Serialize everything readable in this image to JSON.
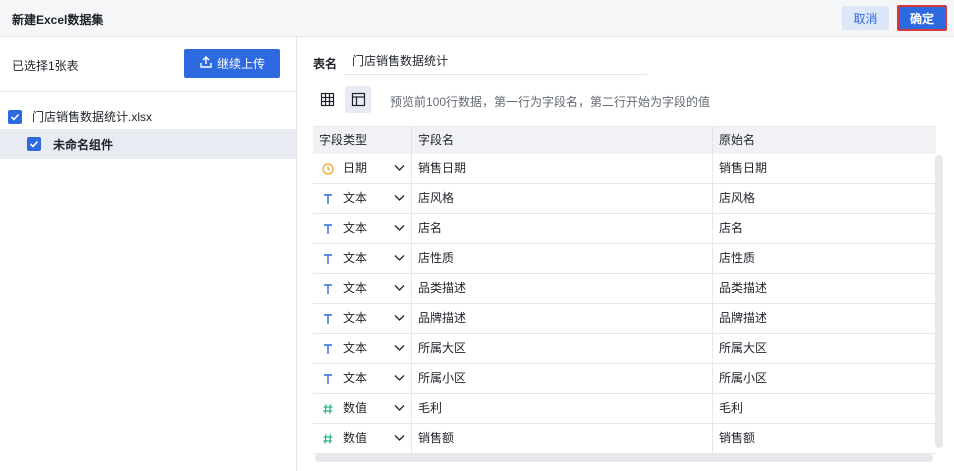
{
  "header": {
    "title": "新建Excel数据集",
    "cancel_label": "取消",
    "ok_label": "确定"
  },
  "sidebar": {
    "selected_count": "已选择1张表",
    "upload_label": "继续上传",
    "file": {
      "name": "门店销售数据统计.xlsx",
      "checked": true
    },
    "sheet": {
      "name": "未命名组件",
      "checked": true
    }
  },
  "main": {
    "table_name_label": "表名",
    "table_name_value": "门店销售数据统计",
    "hint": "预览前100行数据，第一行为字段名，第二行开始为字段的值",
    "columns": [
      "字段类型",
      "字段名",
      "原始名"
    ],
    "rows": [
      {
        "type": "日期",
        "icon": "clock-icon",
        "field": "销售日期",
        "original": "销售日期"
      },
      {
        "type": "文本",
        "icon": "text-type-icon",
        "field": "店风格",
        "original": "店风格"
      },
      {
        "type": "文本",
        "icon": "text-type-icon",
        "field": "店名",
        "original": "店名"
      },
      {
        "type": "文本",
        "icon": "text-type-icon",
        "field": "店性质",
        "original": "店性质"
      },
      {
        "type": "文本",
        "icon": "text-type-icon",
        "field": "品类描述",
        "original": "品类描述"
      },
      {
        "type": "文本",
        "icon": "text-type-icon",
        "field": "品牌描述",
        "original": "品牌描述"
      },
      {
        "type": "文本",
        "icon": "text-type-icon",
        "field": "所属大区",
        "original": "所属大区"
      },
      {
        "type": "文本",
        "icon": "text-type-icon",
        "field": "所属小区",
        "original": "所属小区"
      },
      {
        "type": "数值",
        "icon": "hash-icon",
        "field": "毛利",
        "original": "毛利"
      },
      {
        "type": "数值",
        "icon": "hash-icon",
        "field": "销售额",
        "original": "销售额"
      }
    ]
  },
  "colors": {
    "primary": "#2d6ae0",
    "highlight_border": "#d9363e",
    "date_icon": "#f0a020",
    "number_icon": "#2bb38a"
  }
}
